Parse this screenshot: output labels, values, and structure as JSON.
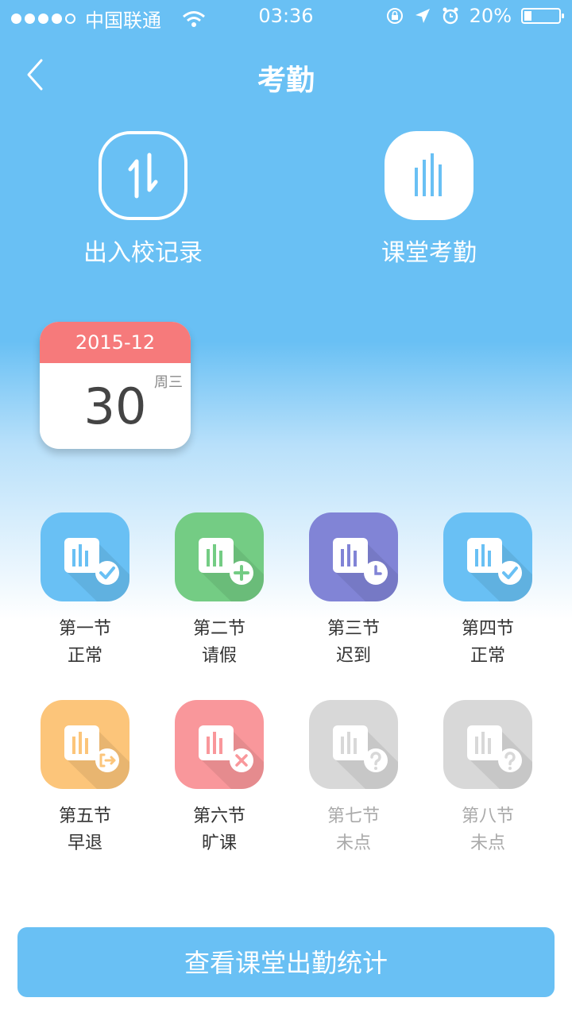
{
  "status": {
    "carrier": "中国联通",
    "time": "03:36",
    "battery": "20%",
    "battery_level": 0.2
  },
  "nav": {
    "title": "考勤"
  },
  "top_buttons": [
    {
      "label": "出入校记录",
      "icon": "swap-arrows-icon"
    },
    {
      "label": "课堂考勤",
      "icon": "bars-icon"
    }
  ],
  "calendar": {
    "month": "2015-12",
    "day": "30",
    "weekday": "周三"
  },
  "lessons": [
    {
      "name": "第一节",
      "status": "正常",
      "color": "#69c0f4",
      "badge": "check"
    },
    {
      "name": "第二节",
      "status": "请假",
      "color": "#74cc84",
      "badge": "plus"
    },
    {
      "name": "第三节",
      "status": "迟到",
      "color": "#8184d6",
      "badge": "clock"
    },
    {
      "name": "第四节",
      "status": "正常",
      "color": "#69c0f4",
      "badge": "check"
    },
    {
      "name": "第五节",
      "status": "早退",
      "color": "#fcc57a",
      "badge": "exit"
    },
    {
      "name": "第六节",
      "status": "旷课",
      "color": "#f9979b",
      "badge": "cross"
    },
    {
      "name": "第七节",
      "status": "未点",
      "color": "#d8d8d8",
      "badge": "question"
    },
    {
      "name": "第八节",
      "status": "未点",
      "color": "#d8d8d8",
      "badge": "question"
    }
  ],
  "footer": {
    "button_label": "查看课堂出勤统计"
  }
}
